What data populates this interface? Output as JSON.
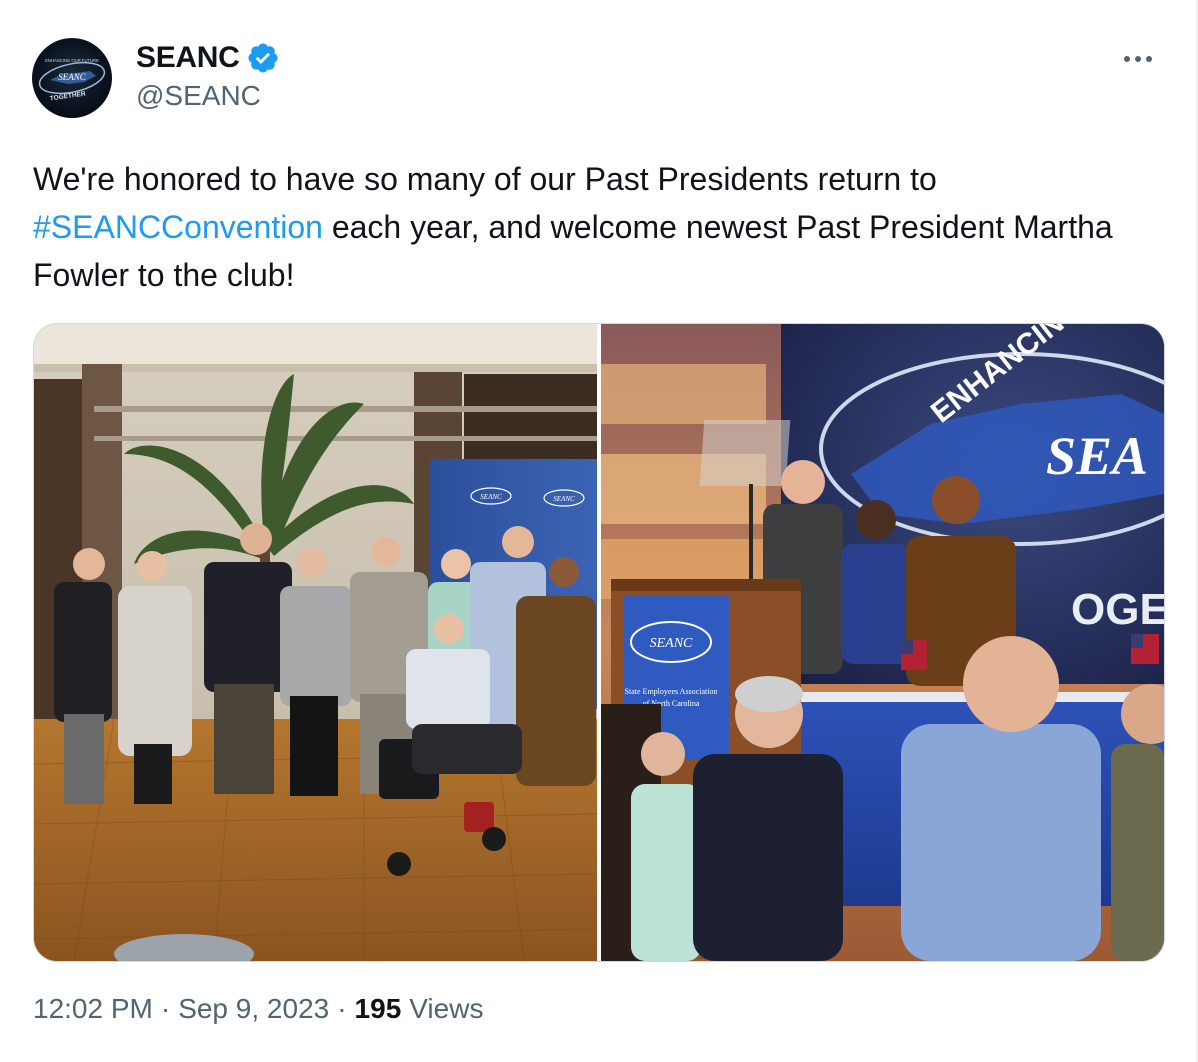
{
  "author": {
    "display_name": "SEANC",
    "handle": "@SEANC",
    "verified_icon": "verified-badge-icon",
    "avatar_logo_text": "SEANC",
    "avatar_ring_top": "ENHANCING OUR FUTURE",
    "avatar_ring_bottom": "TOGETHER"
  },
  "tweet": {
    "text_part1": "We're honored to have so many of our Past Presidents return to ",
    "hashtag": "#SEANCConvention",
    "text_part2": " each year, and welcome newest Past President Martha Fowler to the club!"
  },
  "media": {
    "left_photo": {
      "banner_logo_1": "SEANC",
      "banner_logo_2": "SEANC"
    },
    "right_photo": {
      "screen_text_top": "ENHANCING",
      "screen_logo": "SEA",
      "screen_text_bottom": "OGET",
      "podium_logo": "SEANC",
      "podium_line1": "State Employees Association",
      "podium_line2": "of North Carolina"
    }
  },
  "meta": {
    "time": "12:02 PM",
    "separator": "·",
    "date": "Sep 9, 2023",
    "views_count": "195",
    "views_label": "Views"
  },
  "colors": {
    "accent": "#1d9bf0",
    "text": "#0f1419",
    "secondary": "#536471"
  }
}
